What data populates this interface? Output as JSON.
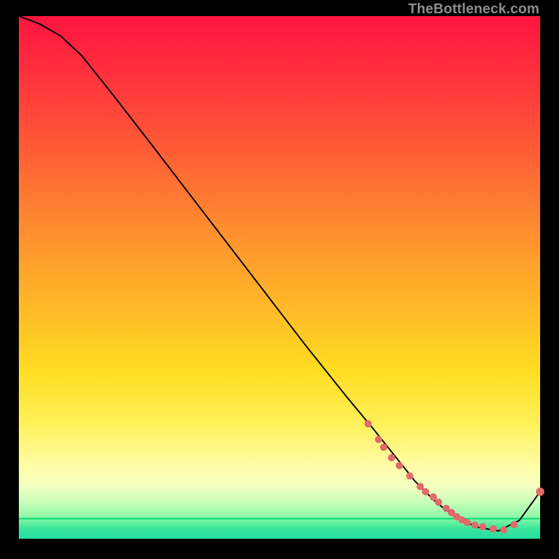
{
  "watermark": "TheBottleneck.com",
  "chart_data": {
    "type": "line",
    "title": "",
    "xlabel": "",
    "ylabel": "",
    "xlim": [
      0,
      100
    ],
    "ylim": [
      0,
      100
    ],
    "grid": false,
    "legend": false,
    "series": [
      {
        "name": "curve",
        "x": [
          0,
          4,
          8,
          12,
          18,
          25,
          35,
          45,
          55,
          63,
          68,
          72,
          76,
          80,
          84,
          88,
          92,
          96,
          100
        ],
        "y": [
          100,
          98.5,
          96.2,
          92.5,
          85,
          76,
          63,
          50,
          37,
          27,
          21,
          16,
          11,
          7,
          4,
          2.2,
          1.5,
          3.5,
          9
        ],
        "color": "#000000"
      },
      {
        "name": "markers",
        "type": "scatter",
        "x": [
          67,
          69,
          70,
          71.5,
          73,
          75,
          77,
          78,
          79.5,
          80.5,
          82,
          83,
          84,
          85,
          86,
          87.5,
          89,
          91,
          93,
          95,
          100
        ],
        "y": [
          22,
          19,
          17.5,
          15.5,
          14,
          12,
          10,
          9,
          8,
          7,
          5.8,
          5,
          4.2,
          3.6,
          3.1,
          2.6,
          2.3,
          1.9,
          1.7,
          2.7,
          9
        ],
        "color": "#e16a6a"
      }
    ],
    "background_gradient": {
      "direction": "vertical",
      "stops": [
        {
          "pos": 0.0,
          "color": "#ff153f"
        },
        {
          "pos": 0.4,
          "color": "#ff8b2f"
        },
        {
          "pos": 0.68,
          "color": "#ffdd22"
        },
        {
          "pos": 0.86,
          "color": "#fffca7"
        },
        {
          "pos": 0.96,
          "color": "#8af7a8"
        },
        {
          "pos": 1.0,
          "color": "#26dca3"
        }
      ]
    }
  }
}
